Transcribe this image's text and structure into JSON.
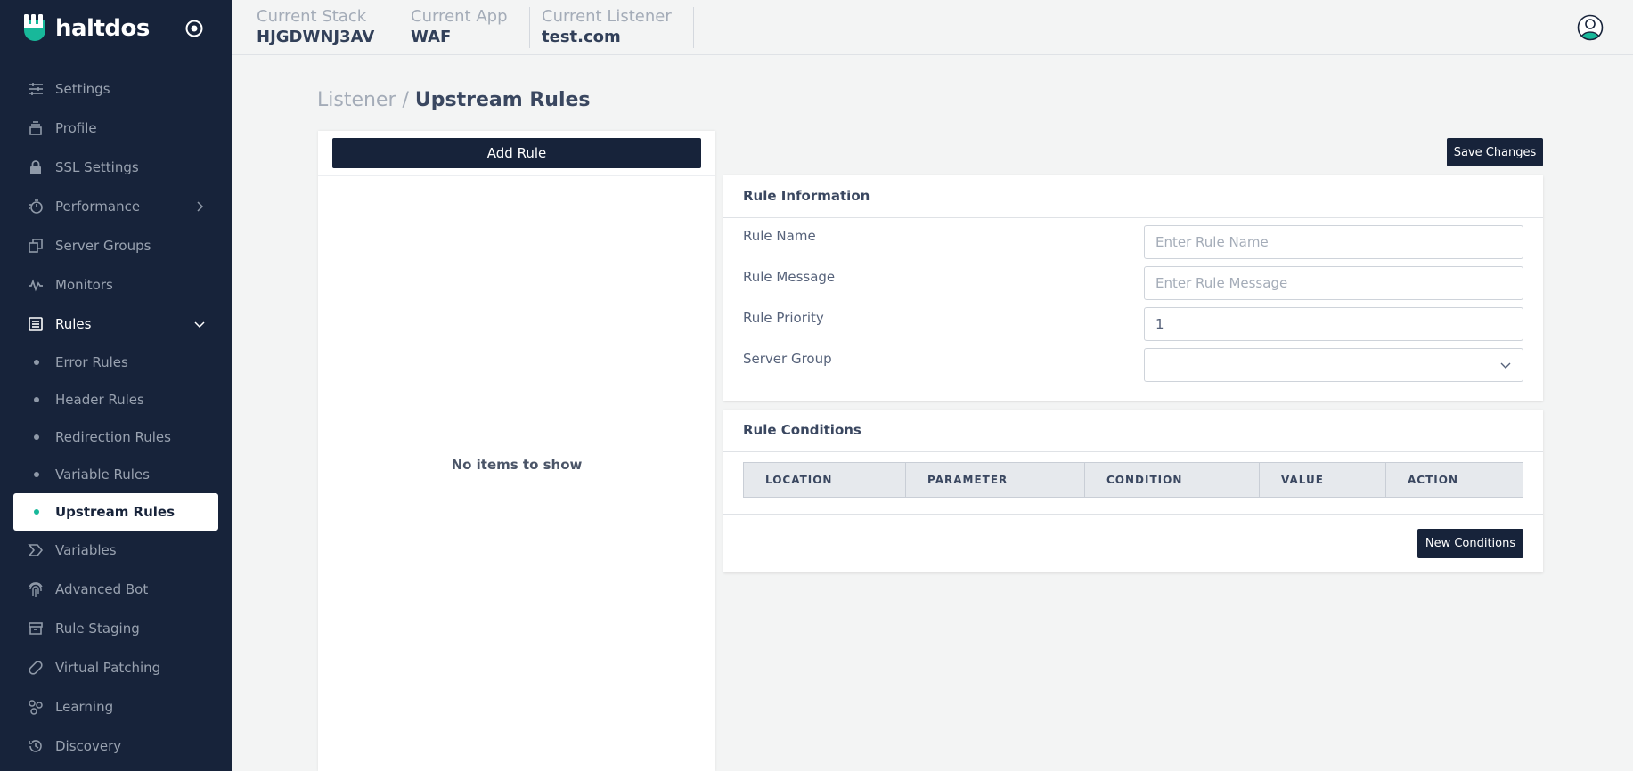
{
  "app": {
    "name": "haltdos"
  },
  "header": {
    "stack": {
      "label": "Current Stack",
      "value": "HJGDWNJ3AV"
    },
    "app": {
      "label": "Current App",
      "value": "WAF"
    },
    "listener": {
      "label": "Current Listener",
      "value": "test.com"
    }
  },
  "sidebar": {
    "items": [
      {
        "label": "Settings",
        "icon": "sliders-icon"
      },
      {
        "label": "Profile",
        "icon": "layers-icon"
      },
      {
        "label": "SSL Settings",
        "icon": "lock-icon"
      },
      {
        "label": "Performance",
        "icon": "speed-icon"
      },
      {
        "label": "Server Groups",
        "icon": "copy-icon"
      },
      {
        "label": "Monitors",
        "icon": "pulse-icon"
      },
      {
        "label": "Rules",
        "icon": "list-icon"
      }
    ],
    "rules_sub": [
      {
        "label": "Error Rules"
      },
      {
        "label": "Header Rules"
      },
      {
        "label": "Redirection Rules"
      },
      {
        "label": "Variable Rules"
      },
      {
        "label": "Upstream Rules"
      }
    ],
    "items_after": [
      {
        "label": "Variables",
        "icon": "tag-icon"
      },
      {
        "label": "Advanced Bot",
        "icon": "fingerprint-icon"
      },
      {
        "label": "Rule Staging",
        "icon": "archive-icon"
      },
      {
        "label": "Virtual Patching",
        "icon": "bandage-icon"
      },
      {
        "label": "Learning",
        "icon": "network-icon"
      },
      {
        "label": "Discovery",
        "icon": "history-icon"
      }
    ]
  },
  "breadcrumb": {
    "parent": "Listener /",
    "current": "Upstream Rules"
  },
  "list": {
    "add_label": "Add Rule",
    "empty": "No items to show"
  },
  "save_label": "Save Changes",
  "rule_info": {
    "title": "Rule Information",
    "name_label": "Rule Name",
    "name_placeholder": "Enter Rule Name",
    "message_label": "Rule Message",
    "message_placeholder": "Enter Rule Message",
    "priority_label": "Rule Priority",
    "priority_value": "1",
    "group_label": "Server Group",
    "group_value": ""
  },
  "conditions": {
    "title": "Rule Conditions",
    "columns": [
      "LOCATION",
      "PARAMETER",
      "CONDITION",
      "VALUE",
      "ACTION"
    ],
    "new_label": "New Conditions"
  },
  "colors": {
    "sidebar": "#17233a",
    "accent": "#18b89a",
    "button": "#17233a"
  }
}
